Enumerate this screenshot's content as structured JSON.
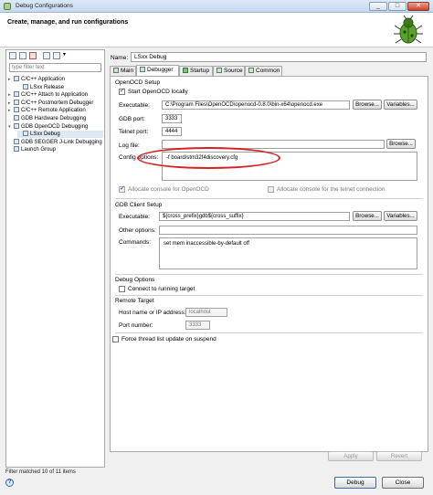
{
  "window": {
    "title": "Debug Configurations"
  },
  "header": {
    "title": "Create, manage, and run configurations"
  },
  "left": {
    "filter_placeholder": "type filter text",
    "tree": [
      {
        "label": "C/C++ Application",
        "level": 0,
        "expand": "▸"
      },
      {
        "label": "LSxx Release",
        "level": 1,
        "expand": ""
      },
      {
        "label": "C/C++ Attach to Application",
        "level": 0,
        "expand": "▸"
      },
      {
        "label": "C/C++ Postmortem Debugger",
        "level": 0,
        "expand": "▸"
      },
      {
        "label": "C/C++ Remote Application",
        "level": 0,
        "expand": "▸"
      },
      {
        "label": "GDB Hardware Debugging",
        "level": 0,
        "expand": ""
      },
      {
        "label": "GDB OpenOCD Debugging",
        "level": 0,
        "expand": "▾"
      },
      {
        "label": "LSxx Debug",
        "level": 1,
        "expand": ""
      },
      {
        "label": "GDB SEGGER J-Link Debugging",
        "level": 0,
        "expand": ""
      },
      {
        "label": "Launch Group",
        "level": 0,
        "expand": ""
      }
    ],
    "status": "Filter matched 10 of 11 items"
  },
  "config": {
    "name_label": "Name:",
    "name_value": "LSxx Debug",
    "tabs": [
      "Main",
      "Debugger",
      "Startup",
      "Source",
      "Common"
    ],
    "openocd": {
      "group": "OpenOCD Setup",
      "start_label": "Start OpenOCD locally",
      "executable_label": "Executable:",
      "executable_value": "C:\\Program Files\\OpenOCD\\openocd-0.8.0\\bin-x64\\openocd.exe",
      "gdb_port_label": "GDB port:",
      "gdb_port_value": "3333",
      "telnet_port_label": "Telnet port:",
      "telnet_port_value": "4444",
      "log_label": "Log file:",
      "config_label": "Config options:",
      "config_value": "-f board/stm32f4discovery.cfg",
      "alloc_console": "Allocate console for OpenOCD",
      "alloc_telnet": "Allocate console for the telnet connection"
    },
    "gdb": {
      "group": "GDB Client Setup",
      "executable_label": "Executable:",
      "executable_value": "${cross_prefix}gdb${cross_suffix}",
      "other_label": "Other options:",
      "commands_label": "Commands:",
      "commands_value": "set mem inaccessible-by-default off"
    },
    "debug_opts": {
      "group": "Debug Options",
      "connect_label": "Connect to running target"
    },
    "remote": {
      "group": "Remote Target",
      "host_label": "Host name or IP address:",
      "host_value": "localhost",
      "port_label": "Port number:",
      "port_value": "3333"
    },
    "force_label": "Force thread list update on suspend",
    "browse": "Browse...",
    "variables": "Variables...",
    "apply": "Apply",
    "revert": "Revert"
  },
  "footer": {
    "debug": "Debug",
    "close": "Close",
    "help": "?"
  },
  "colors": {
    "accent": "#3a6ea5",
    "highlight_ellipse": "#d62020"
  }
}
